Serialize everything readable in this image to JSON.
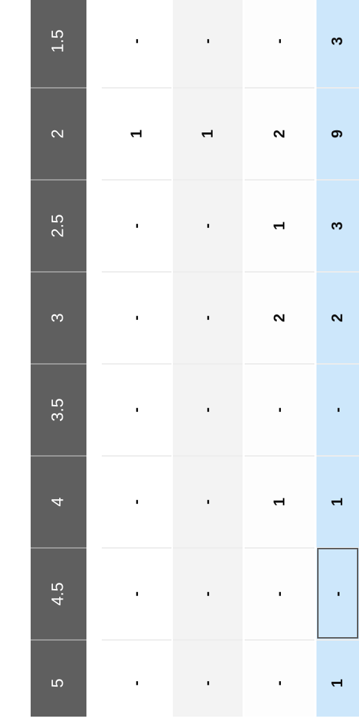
{
  "table": {
    "headers": [
      "1.5",
      "2",
      "2.5",
      "3",
      "3.5",
      "4",
      "4.5",
      "5"
    ],
    "columns": [
      {
        "name": "row-1",
        "values": [
          "-",
          "1",
          "-",
          "-",
          "-",
          "-",
          "-",
          "-"
        ]
      },
      {
        "name": "row-2",
        "values": [
          "-",
          "1",
          "-",
          "-",
          "-",
          "-",
          "-",
          "-"
        ]
      },
      {
        "name": "row-3",
        "values": [
          "-",
          "2",
          "1",
          "2",
          "-",
          "1",
          "-",
          "-"
        ]
      },
      {
        "name": "totals-row",
        "values": [
          "3",
          "9",
          "3",
          "2",
          "-",
          "1",
          "-",
          "1"
        ]
      }
    ],
    "selected_cell": {
      "column": 3,
      "row": 6
    },
    "colors": {
      "header_bg": "#5f5f5f",
      "header_text": "#ffffff",
      "row_bg_1": "#ffffff",
      "row_bg_2": "#f3f3f3",
      "row_bg_3": "#fdfdfd",
      "totals_bg": "#cde7fb",
      "selection_border": "#5a5a5a"
    }
  }
}
